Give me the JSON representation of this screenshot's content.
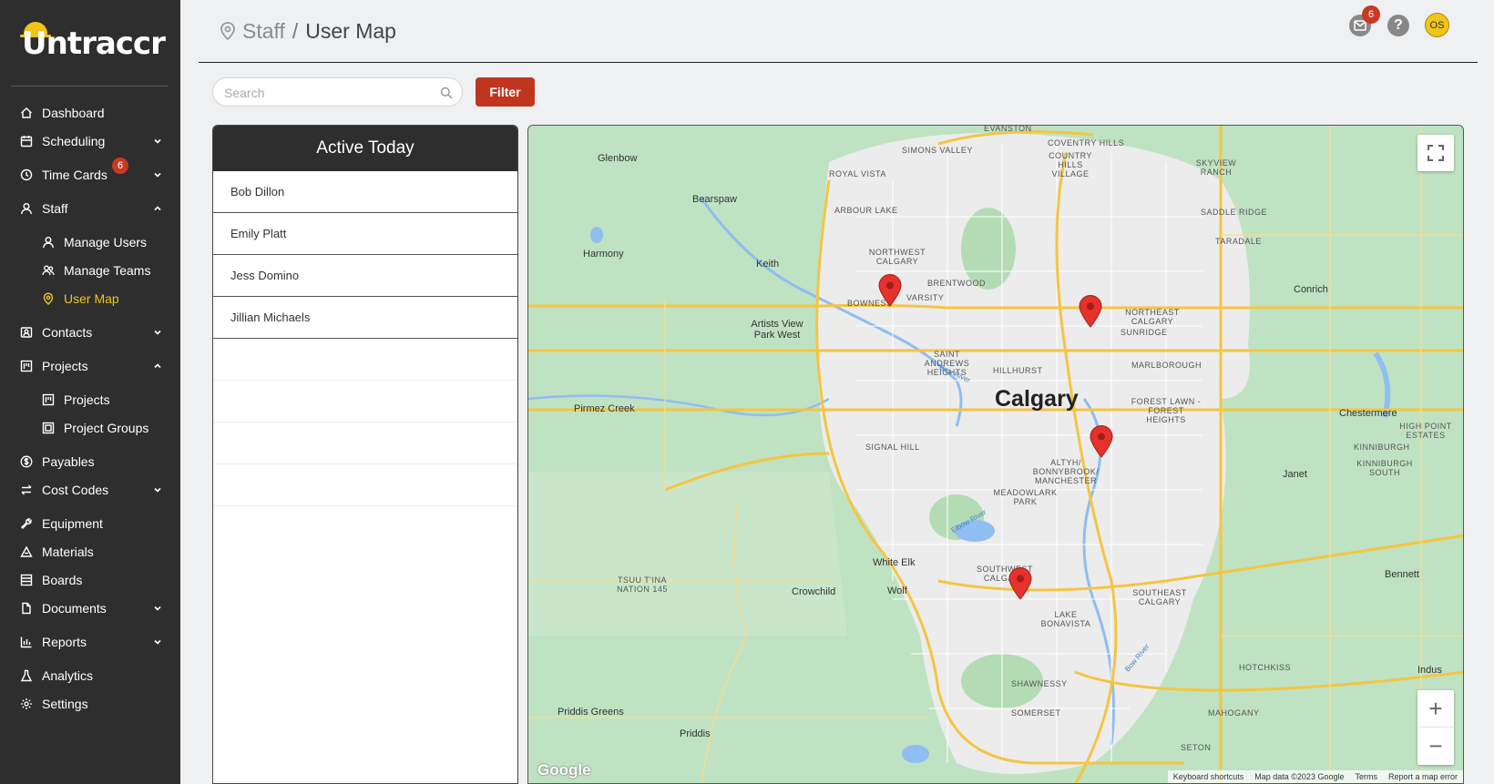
{
  "app": {
    "logo_text": "Untraccr"
  },
  "sidebar": {
    "items": [
      {
        "label": "Dashboard",
        "icon": "home-icon"
      },
      {
        "label": "Scheduling",
        "icon": "calendar-icon"
      },
      {
        "label": "Time Cards",
        "icon": "clock-icon",
        "badge": "6"
      },
      {
        "label": "Staff",
        "icon": "user-icon"
      },
      {
        "label": "Manage Users",
        "icon": "user-icon"
      },
      {
        "label": "Manage Teams",
        "icon": "team-icon"
      },
      {
        "label": "User Map",
        "icon": "location-pin-icon"
      },
      {
        "label": "Contacts",
        "icon": "contacts-icon"
      },
      {
        "label": "Projects",
        "icon": "project-icon"
      },
      {
        "label": "Projects",
        "icon": "project-icon"
      },
      {
        "label": "Project Groups",
        "icon": "project-group-icon"
      },
      {
        "label": "Payables",
        "icon": "dollar-icon"
      },
      {
        "label": "Cost Codes",
        "icon": "swap-icon"
      },
      {
        "label": "Equipment",
        "icon": "wrench-icon"
      },
      {
        "label": "Materials",
        "icon": "materials-icon"
      },
      {
        "label": "Boards",
        "icon": "board-icon"
      },
      {
        "label": "Documents",
        "icon": "document-icon"
      },
      {
        "label": "Reports",
        "icon": "bar-chart-icon"
      },
      {
        "label": "Analytics",
        "icon": "flask-icon"
      },
      {
        "label": "Settings",
        "icon": "gear-icon"
      }
    ]
  },
  "header": {
    "breadcrumb_parent": "Staff",
    "breadcrumb_sep": "/",
    "breadcrumb_current": "User Map",
    "notification_count": "6",
    "help_label": "?",
    "avatar_initials": "OS"
  },
  "toolbar": {
    "search_placeholder": "Search",
    "filter_label": "Filter"
  },
  "active_today": {
    "title": "Active Today",
    "users": [
      "Bob Dillon",
      "Emily Platt",
      "Jess Domino",
      "Jillian Michaels"
    ]
  },
  "map": {
    "city_label": "Calgary",
    "labels": [
      "EVANSTON",
      "SIMONS VALLEY",
      "COVENTRY HILLS",
      "COUNTRY HILLS VILLAGE",
      "SKYVIEW RANCH",
      "Glenbow",
      "ROYAL VISTA",
      "Bearspaw",
      "ARBOUR LAKE",
      "SADDLE RIDGE",
      "Harmony",
      "TARADALE",
      "NORTHWEST CALGARY",
      "Keith",
      "BRENTWOOD",
      "Conrich",
      "BOWNESS",
      "VARSITY",
      "NORTHEAST CALGARY",
      "SUNRIDGE",
      "Artists View Park West",
      "SAINT ANDREWS HEIGHTS",
      "HILLHURST",
      "MARLBOROUGH",
      "Bow River",
      "FOREST LAWN - FOREST HEIGHTS",
      "Pirmez Creek",
      "Chestermere",
      "HIGH POINT ESTATES",
      "KINNIBURGH",
      "SIGNAL HILL",
      "ALTYH/ BONNYBROOK/ MANCHESTER",
      "KINNIBURGH SOUTH",
      "Janet",
      "MEADOWLARK PARK",
      "Elbow River",
      "White Elk",
      "SOUTHWEST CALGARY",
      "TSUU T'INA NATION 145",
      "Crowchild",
      "Wolf",
      "SOUTHEAST CALGARY",
      "Bennett",
      "LAKE BONAVISTA",
      "HOTCHKISS",
      "Indus",
      "SHAWNESSY",
      "Bow River",
      "Priddis Greens",
      "SOMERSET",
      "MAHOGANY",
      "Priddis",
      "SETON"
    ],
    "zoom_in_label": "+",
    "zoom_out_label": "−",
    "logo_text": "Google",
    "footer": [
      "Keyboard shortcuts",
      "Map data ©2023 Google",
      "Terms",
      "Report a map error"
    ],
    "pins": [
      {
        "name": "map-pin-bowness"
      },
      {
        "name": "map-pin-northeast"
      },
      {
        "name": "map-pin-forest-lawn"
      },
      {
        "name": "map-pin-southwest"
      }
    ]
  }
}
